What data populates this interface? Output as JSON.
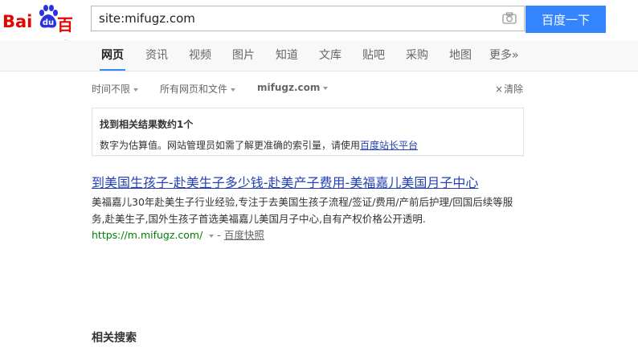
{
  "logo": {
    "text_latin": "Bai",
    "text_paw": "du",
    "text_cn": "百度"
  },
  "search": {
    "query": "site:mifugz.com",
    "button_label": "百度一下"
  },
  "tabs": [
    {
      "label": "网页",
      "active": true
    },
    {
      "label": "资讯"
    },
    {
      "label": "视频"
    },
    {
      "label": "图片"
    },
    {
      "label": "知道"
    },
    {
      "label": "文库"
    },
    {
      "label": "贴吧"
    },
    {
      "label": "采购"
    },
    {
      "label": "地图"
    },
    {
      "label": "更多»"
    }
  ],
  "filters": {
    "time": "时间不限",
    "type": "所有网页和文件",
    "site": "mifugz.com",
    "clear": "清除"
  },
  "notice": {
    "title": "找到相关结果数约1个",
    "text": "数字为估算值。网站管理员如需了解更准确的索引量，请使用",
    "link": "百度站长平台"
  },
  "result": {
    "title": "到美国生孩子-赴美生子多少钱-赴美产子费用-美福嘉儿美国月子中心",
    "desc": "美福嘉儿30年赴美生子行业经验,专注于去美国生孩子流程/签证/费用/产前后护理/回国后续等服务,赴美生子,国外生孩子首选美福嘉儿美国月子中心,自有产权价格公开透明.",
    "url": "https://m.mifugz.com/",
    "dash": "-",
    "snapshot": "百度快照"
  },
  "related": {
    "title": "相关搜索"
  },
  "colors": {
    "brand_red": "#e10602",
    "brand_blue": "#2932e1",
    "button_blue": "#3385ff",
    "link_blue": "#2440b3",
    "url_green": "#008000"
  }
}
